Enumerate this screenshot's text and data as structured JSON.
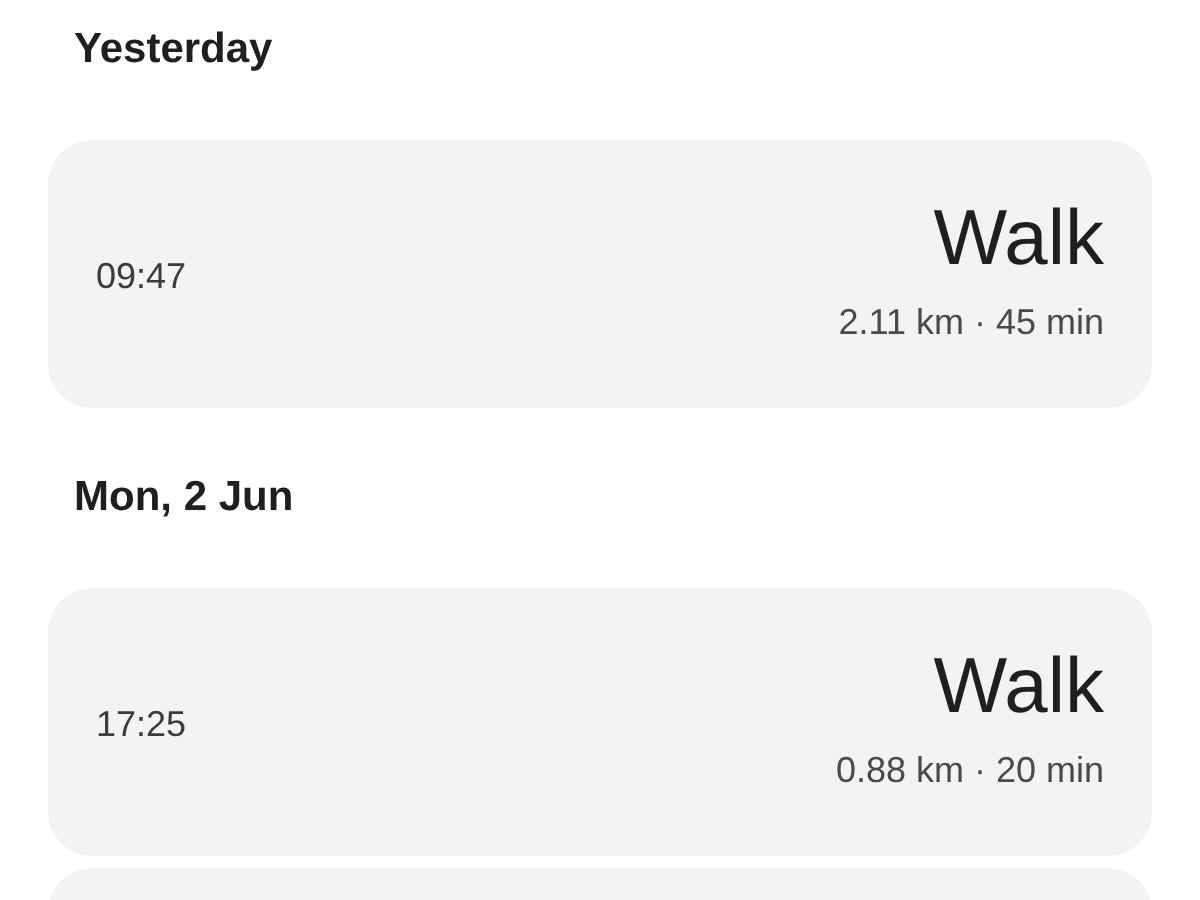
{
  "sections": [
    {
      "heading": "Yesterday",
      "activities": [
        {
          "time": "09:47",
          "name": "Walk",
          "stats": "2.11 km · 45 min"
        }
      ]
    },
    {
      "heading": "Mon, 2 Jun",
      "activities": [
        {
          "time": "17:25",
          "name": "Walk",
          "stats": "0.88 km · 20 min"
        }
      ]
    }
  ]
}
